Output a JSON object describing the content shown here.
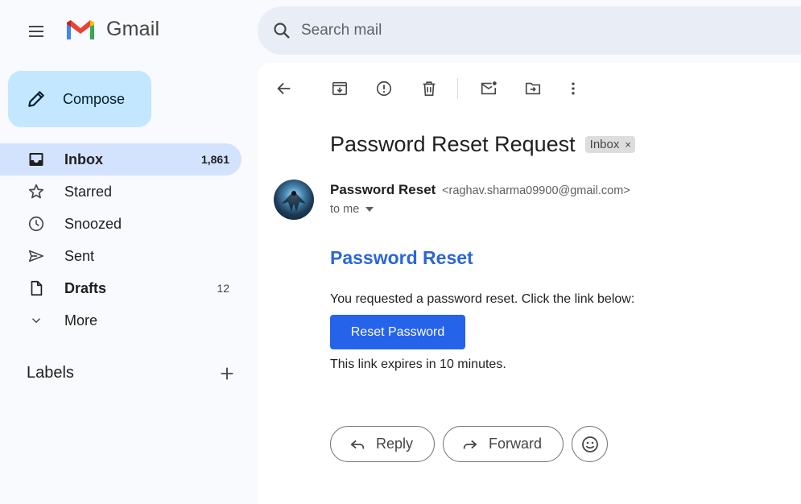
{
  "app": {
    "name": "Gmail"
  },
  "search": {
    "placeholder": "Search mail"
  },
  "compose": {
    "label": "Compose"
  },
  "sidebar": {
    "items": [
      {
        "label": "Inbox",
        "count": "1,861",
        "icon": "inbox-icon"
      },
      {
        "label": "Starred",
        "count": "",
        "icon": "star-icon"
      },
      {
        "label": "Snoozed",
        "count": "",
        "icon": "clock-icon"
      },
      {
        "label": "Sent",
        "count": "",
        "icon": "send-icon"
      },
      {
        "label": "Drafts",
        "count": "12",
        "icon": "draft-icon"
      },
      {
        "label": "More",
        "count": "",
        "icon": "chevron-down-icon"
      }
    ],
    "labels_title": "Labels"
  },
  "email": {
    "subject": "Password Reset Request",
    "chip_label": "Inbox",
    "chip_close": "×",
    "sender_name": "Password Reset",
    "sender_email": "<raghav.sharma09900@gmail.com>",
    "recipient": "to me",
    "body_heading": "Password Reset",
    "body_text_1": "You requested a password reset. Click the link below:",
    "button_label": "Reset Password",
    "body_text_2": "This link expires in 10 minutes."
  },
  "actions": {
    "reply": "Reply",
    "forward": "Forward"
  },
  "colors": {
    "accent": "#2a66db",
    "button": "#2563eb",
    "compose_bg": "#c2e7ff",
    "active_nav": "#d3e3fd"
  }
}
